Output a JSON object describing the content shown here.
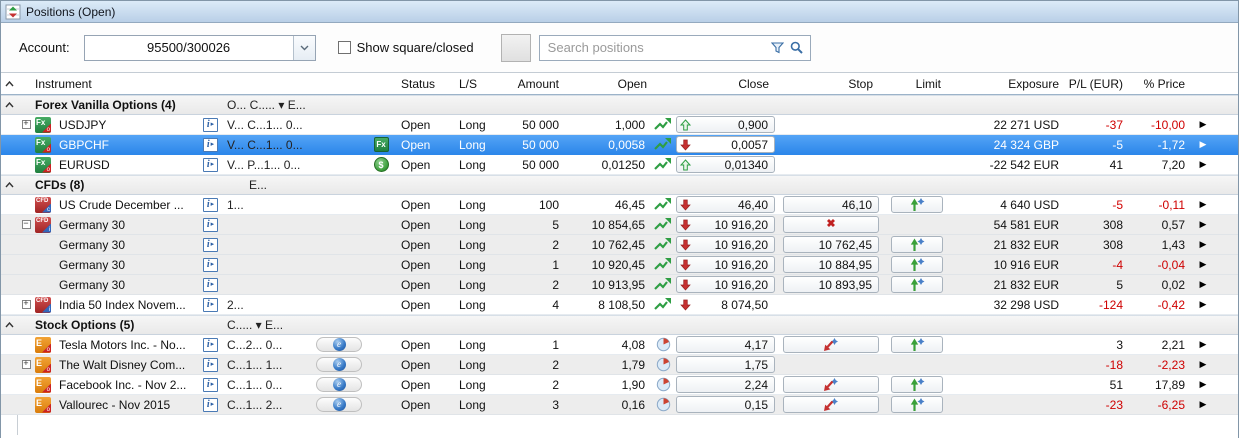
{
  "window": {
    "title": "Positions (Open)"
  },
  "toolbar": {
    "account_label": "Account:",
    "account_value": "95500/300026",
    "checkbox_label": "Show square/closed",
    "search_placeholder": "Search positions"
  },
  "colors": {
    "selected_row": "#3d96f0",
    "negative": "#cf0000",
    "positive_icon_green": "#2f9e44",
    "down_arrow_red": "#c53030",
    "titlebar": "#c9dcf0",
    "accent_blue": "#3a6ea5"
  },
  "table": {
    "header": {
      "instrument": "Instrument",
      "status": "Status",
      "ls": "L/S",
      "amount": "Amount",
      "open": "Open",
      "close": "Close",
      "stop": "Stop",
      "limit": "Limit",
      "exposure": "Exposure",
      "pl": "P/L (EUR)",
      "pct": "% Price"
    },
    "groups": [
      {
        "label": "Forex Vanilla Options (4)",
        "trunc": "O... C..... ▾ E...",
        "trunc_indent": 0,
        "rows": [
          {
            "name": "USDJPY",
            "expand": "plus",
            "icon": "fx-option-icon",
            "info": true,
            "trunc": "V... C...1... 0...",
            "status": "Open",
            "ls": "Long",
            "amount": "50 000",
            "open": "1,000",
            "trend": "pulse-icon",
            "close": {
              "arrow": "up",
              "value": "0,900",
              "boxed": true
            },
            "exposure": "22 271 USD",
            "pl": "-37",
            "pct": "-10,00",
            "bg": "white"
          },
          {
            "name": "GBPCHF",
            "icon": "fx-option-icon",
            "info": true,
            "trunc": "V... C...1... 0...",
            "status_icon": "fx-badge-icon",
            "status": "Open",
            "ls": "Long",
            "amount": "50 000",
            "open": "0,0058",
            "trend": "pulse-icon",
            "close": {
              "arrow": "down",
              "value": "0,0057",
              "boxed": true
            },
            "exposure": "24 324 GBP",
            "pl": "-5",
            "pct": "-1,72",
            "bg": "white",
            "selected": true
          },
          {
            "name": "EURUSD",
            "icon": "fx-option-icon",
            "info": true,
            "trunc": "V... P...1... 0...",
            "status_icon": "dollar-badge-icon",
            "status": "Open",
            "ls": "Long",
            "amount": "50 000",
            "open": "0,01250",
            "trend": "pulse-icon",
            "close": {
              "arrow": "up",
              "value": "0,01340",
              "boxed": true
            },
            "exposure": "-22 542 EUR",
            "pl": "41",
            "pct": "7,20",
            "bg": "white"
          }
        ]
      },
      {
        "label": "CFDs (8)",
        "trunc": "E...",
        "trunc_indent": 22,
        "rows": [
          {
            "name": "US Crude December ...",
            "icon": "cfd-commodity-icon",
            "info": true,
            "trunc": "1...",
            "status": "Open",
            "ls": "Long",
            "amount": "100",
            "open": "46,45",
            "trend": "pulse-icon",
            "close": {
              "arrow": "down",
              "value": "46,40",
              "boxed": true
            },
            "stop": {
              "type": "value",
              "value": "46,10"
            },
            "limit": "icon",
            "exposure": "4 640 USD",
            "pl": "-5",
            "pct": "-0,11",
            "bg": "white"
          },
          {
            "name": "Germany 30",
            "expand": "minus",
            "icon": "cfd-index-icon",
            "info": true,
            "status": "Open",
            "ls": "Long",
            "amount": "5",
            "open": "10 854,65",
            "trend": "pulse-icon",
            "close": {
              "arrow": "down",
              "value": "10 916,20",
              "boxed": true
            },
            "stop": {
              "type": "x"
            },
            "exposure": "54 581 EUR",
            "pl": "308",
            "pct": "0,57",
            "bg": "gray"
          },
          {
            "name": "Germany 30",
            "info": true,
            "status": "Open",
            "ls": "Long",
            "amount": "2",
            "open": "10 762,45",
            "trend": "pulse-icon",
            "close": {
              "arrow": "down",
              "value": "10 916,20",
              "boxed": true
            },
            "stop": {
              "type": "value",
              "value": "10 762,45"
            },
            "limit": "icon",
            "exposure": "21 832 EUR",
            "pl": "308",
            "pct": "1,43",
            "bg": "gray"
          },
          {
            "name": "Germany 30",
            "info": true,
            "status": "Open",
            "ls": "Long",
            "amount": "1",
            "open": "10 920,45",
            "trend": "pulse-icon",
            "close": {
              "arrow": "down",
              "value": "10 916,20",
              "boxed": true
            },
            "stop": {
              "type": "value",
              "value": "10 884,95"
            },
            "limit": "icon",
            "exposure": "10 916 EUR",
            "pl": "-4",
            "pct": "-0,04",
            "bg": "gray"
          },
          {
            "name": "Germany 30",
            "info": true,
            "status": "Open",
            "ls": "Long",
            "amount": "2",
            "open": "10 913,95",
            "trend": "pulse-icon",
            "close": {
              "arrow": "down",
              "value": "10 916,20",
              "boxed": true
            },
            "stop": {
              "type": "value",
              "value": "10 893,95"
            },
            "limit": "icon",
            "exposure": "21 832 EUR",
            "pl": "5",
            "pct": "0,02",
            "bg": "gray"
          },
          {
            "name": "India 50 Index Novem...",
            "expand": "plus",
            "icon": "cfd-index-icon",
            "info": true,
            "trunc": "2...",
            "status": "Open",
            "ls": "Long",
            "amount": "4",
            "open": "8 108,50",
            "trend": "pulse-icon",
            "close": {
              "arrow": "down",
              "value": "8 074,50",
              "boxed": false
            },
            "exposure": "32 298 USD",
            "pl": "-124",
            "pct": "-0,42",
            "bg": "white"
          }
        ]
      },
      {
        "label": "Stock Options (5)",
        "trunc": "C..... ▾ E...",
        "trunc_indent": 0,
        "rows": [
          {
            "name": "Tesla Motors Inc. - No...",
            "icon": "equity-option-icon",
            "info": true,
            "trunc": "C...2... 0...",
            "pill": true,
            "status": "Open",
            "ls": "Long",
            "amount": "1",
            "open": "4,08",
            "trend": "clock-pie-icon",
            "close": {
              "value": "4,17",
              "boxed": true
            },
            "stop": {
              "type": "icon"
            },
            "limit": "icon",
            "exposure": "",
            "pl": "3",
            "pct": "2,21",
            "bg": "white"
          },
          {
            "name": "The Walt Disney Com...",
            "expand": "plus",
            "icon": "equity-option-icon",
            "info": true,
            "trunc": "C...1... 1...",
            "pill": true,
            "status": "Open",
            "ls": "Long",
            "amount": "2",
            "open": "1,79",
            "trend": "clock-pie-icon",
            "close": {
              "value": "1,75",
              "boxed": true
            },
            "exposure": "",
            "pl": "-18",
            "pct": "-2,23",
            "bg": "gray"
          },
          {
            "name": "Facebook Inc. - Nov 2...",
            "icon": "equity-option-icon",
            "info": true,
            "trunc": "C...1... 0...",
            "pill": true,
            "status": "Open",
            "ls": "Long",
            "amount": "2",
            "open": "1,90",
            "trend": "clock-pie-icon",
            "close": {
              "value": "2,24",
              "boxed": true
            },
            "stop": {
              "type": "icon"
            },
            "limit": "icon",
            "exposure": "",
            "pl": "51",
            "pct": "17,89",
            "bg": "white"
          },
          {
            "name": "Vallourec - Nov 2015",
            "icon": "equity-option-icon",
            "info": true,
            "trunc": "C...1... 2...",
            "pill": true,
            "status": "Open",
            "ls": "Long",
            "amount": "3",
            "open": "0,16",
            "trend": "clock-pie-icon",
            "close": {
              "value": "0,15",
              "boxed": true
            },
            "stop": {
              "type": "icon"
            },
            "limit": "icon",
            "exposure": "",
            "pl": "-23",
            "pct": "-6,25",
            "bg": "gray"
          }
        ]
      }
    ]
  }
}
